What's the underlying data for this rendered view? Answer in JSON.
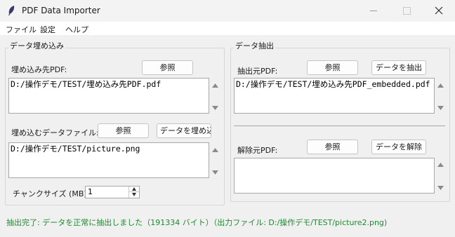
{
  "window": {
    "title": "PDF Data Importer"
  },
  "menu": {
    "items": [
      "ファイル",
      "設定",
      "ヘルプ"
    ]
  },
  "embed": {
    "group_label": "データ埋め込み",
    "target_label": "埋め込み先PDF:",
    "target_browse": "参照",
    "target_path": "D:/操作デモ/TEST/埋め込み先PDF.pdf",
    "file_label": "埋め込むデータファイル:",
    "file_browse": "参照",
    "embed_button": "データを埋め込む",
    "file_path": "D:/操作デモ/TEST/picture.png",
    "chunk_label": "チャンクサイズ (MB):",
    "chunk_value": "1"
  },
  "extract": {
    "group_label": "データ抽出",
    "source_label": "抽出元PDF:",
    "source_browse": "参照",
    "extract_button": "データを抽出",
    "source_path": "D:/操作デモ/TEST/埋め込み先PDF_embedded.pdf",
    "release_label": "解除元PDF:",
    "release_browse": "参照",
    "release_button": "データを解除",
    "release_path": ""
  },
  "status": {
    "text": "抽出完了: データを正常に抽出しました（191334 バイト）（出力ファイル: D:/操作デモ/TEST/picture2.png)",
    "color": "#1e8a2e"
  },
  "icons": {
    "app": "feather-icon",
    "close": "close-icon",
    "scroll_up": "triangle-up-icon",
    "scroll_down": "triangle-down-icon"
  }
}
